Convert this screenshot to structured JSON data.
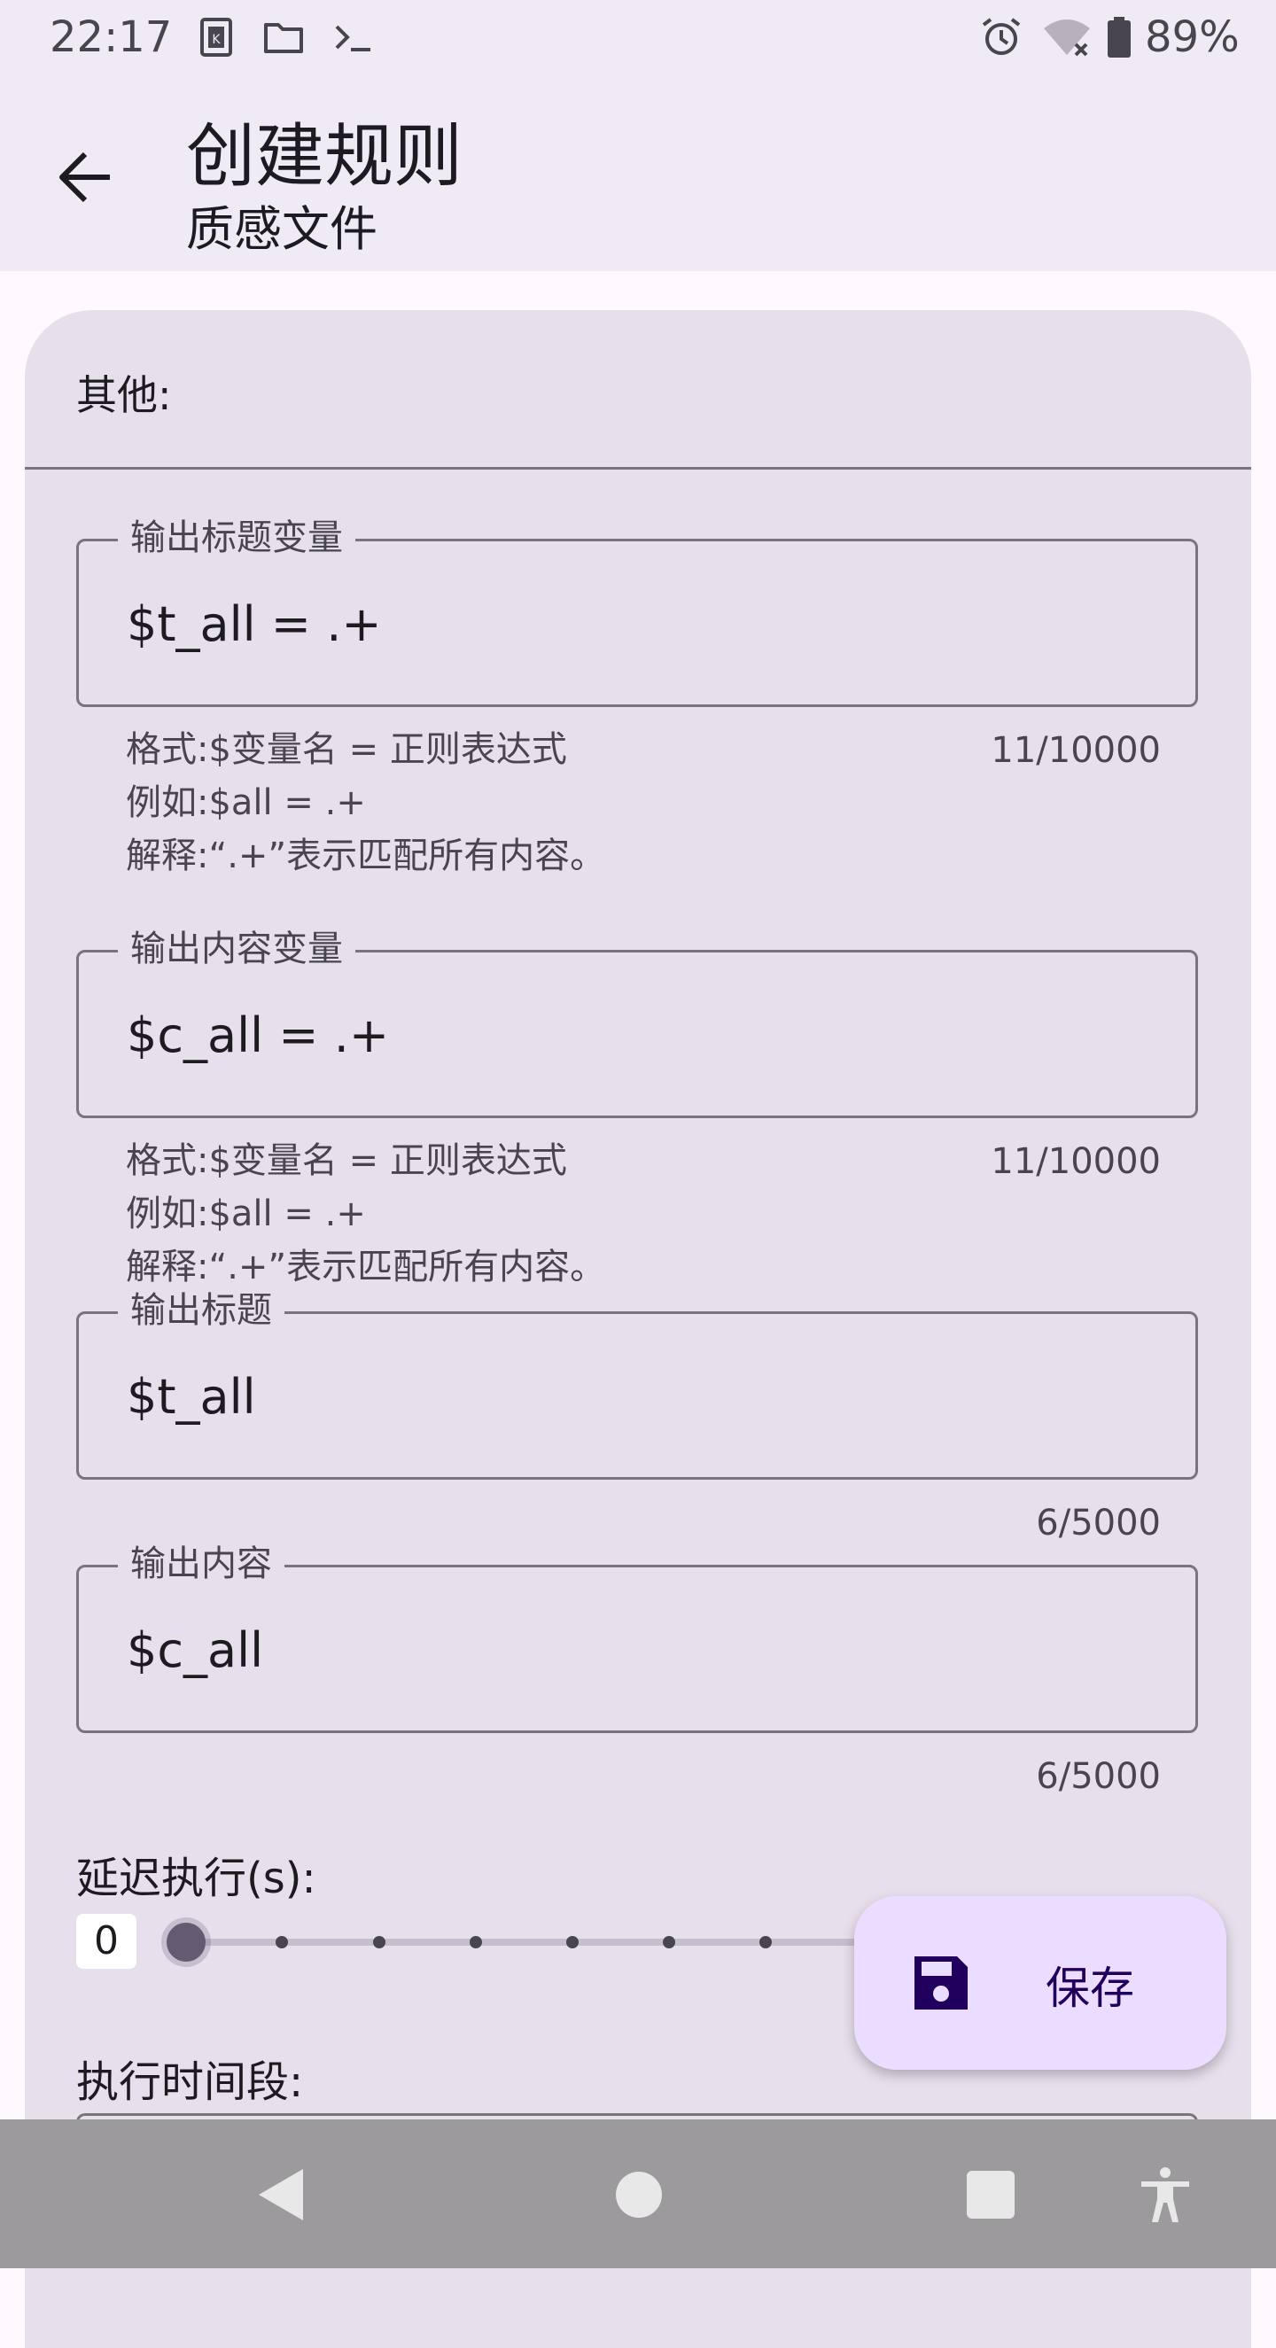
{
  "status_bar": {
    "time": "22:17",
    "battery": "89%",
    "icons": [
      "k-app-icon",
      "folder-icon",
      "terminal-icon",
      "alarm-icon",
      "wifi-off-icon",
      "battery-icon"
    ]
  },
  "app_bar": {
    "title": "创建规则",
    "subtitle": "质感文件",
    "back_icon": "arrow-back-icon"
  },
  "section": {
    "header": "其他:"
  },
  "fields": {
    "title_var": {
      "label": "输出标题变量",
      "value": "$t_all = .+",
      "helper_format": "格式:$变量名 = 正则表达式",
      "helper_example": "例如:$all = .+",
      "helper_explain": "解释:“.+”表示匹配所有内容。",
      "counter": "11/10000"
    },
    "content_var": {
      "label": "输出内容变量",
      "value": "$c_all = .+",
      "helper_format": "格式:$变量名 = 正则表达式",
      "helper_example": "例如:$all = .+",
      "helper_explain": "解释:“.+”表示匹配所有内容。",
      "counter": "11/10000"
    },
    "output_title": {
      "label": "输出标题",
      "value": "$t_all",
      "counter": "6/5000"
    },
    "output_content": {
      "label": "输出内容",
      "value": "$c_all",
      "counter": "6/5000"
    }
  },
  "delay": {
    "label": "延迟执行(s):",
    "value": "0",
    "slider_fraction": 0
  },
  "schedule": {
    "label": "执行时间段:"
  },
  "fab": {
    "label": "保存",
    "icon": "save-icon"
  },
  "nav_bar": {
    "icons": [
      "nav-back-icon",
      "nav-home-icon",
      "nav-recents-icon",
      "accessibility-icon"
    ]
  },
  "colors": {
    "surface": "#efeaf4",
    "card": "#e7e0ec",
    "outline": "#79747e",
    "fab": "#eaddff",
    "on_fab": "#21005d"
  }
}
